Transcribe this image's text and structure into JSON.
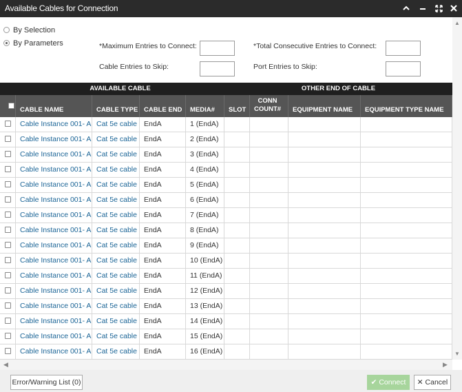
{
  "window": {
    "title": "Available Cables for Connection"
  },
  "mode": {
    "by_selection_label": "By Selection",
    "by_parameters_label": "By Parameters",
    "selected": "By Parameters"
  },
  "params": {
    "max_entries_label": "*Maximum Entries to Connect:",
    "total_consecutive_label": "*Total Consecutive Entries to Connect:",
    "cable_skip_label": "Cable Entries to Skip:",
    "port_skip_label": "Port Entries to Skip:",
    "max_entries_value": "",
    "total_consecutive_value": "",
    "cable_skip_value": "",
    "port_skip_value": ""
  },
  "table": {
    "group_available": "AVAILABLE CABLE",
    "group_other_end": "OTHER END OF CABLE",
    "columns": {
      "cable_name": "CABLE NAME",
      "cable_type": "CABLE TYPE",
      "cable_end": "CABLE END",
      "media": "MEDIA#",
      "slot": "SLOT",
      "conn_count_line1": "CONN",
      "conn_count_line2": "COUNT#",
      "equipment_name": "EQUIPMENT NAME",
      "equipment_type_name": "EQUIPMENT TYPE NAME"
    },
    "rows": [
      {
        "cable_name": "Cable Instance 001- A",
        "cable_type": "Cat 5e cable",
        "cable_end": "EndA",
        "media": "1 (EndA)",
        "slot": "",
        "conn_count": "",
        "equipment_name": "",
        "equipment_type_name": ""
      },
      {
        "cable_name": "Cable Instance 001- A",
        "cable_type": "Cat 5e cable",
        "cable_end": "EndA",
        "media": "2 (EndA)",
        "slot": "",
        "conn_count": "",
        "equipment_name": "",
        "equipment_type_name": ""
      },
      {
        "cable_name": "Cable Instance 001- A",
        "cable_type": "Cat 5e cable",
        "cable_end": "EndA",
        "media": "3 (EndA)",
        "slot": "",
        "conn_count": "",
        "equipment_name": "",
        "equipment_type_name": ""
      },
      {
        "cable_name": "Cable Instance 001- A",
        "cable_type": "Cat 5e cable",
        "cable_end": "EndA",
        "media": "4 (EndA)",
        "slot": "",
        "conn_count": "",
        "equipment_name": "",
        "equipment_type_name": ""
      },
      {
        "cable_name": "Cable Instance 001- A",
        "cable_type": "Cat 5e cable",
        "cable_end": "EndA",
        "media": "5 (EndA)",
        "slot": "",
        "conn_count": "",
        "equipment_name": "",
        "equipment_type_name": ""
      },
      {
        "cable_name": "Cable Instance 001- A",
        "cable_type": "Cat 5e cable",
        "cable_end": "EndA",
        "media": "6 (EndA)",
        "slot": "",
        "conn_count": "",
        "equipment_name": "",
        "equipment_type_name": ""
      },
      {
        "cable_name": "Cable Instance 001- A",
        "cable_type": "Cat 5e cable",
        "cable_end": "EndA",
        "media": "7 (EndA)",
        "slot": "",
        "conn_count": "",
        "equipment_name": "",
        "equipment_type_name": ""
      },
      {
        "cable_name": "Cable Instance 001- A",
        "cable_type": "Cat 5e cable",
        "cable_end": "EndA",
        "media": "8 (EndA)",
        "slot": "",
        "conn_count": "",
        "equipment_name": "",
        "equipment_type_name": ""
      },
      {
        "cable_name": "Cable Instance 001- A",
        "cable_type": "Cat 5e cable",
        "cable_end": "EndA",
        "media": "9 (EndA)",
        "slot": "",
        "conn_count": "",
        "equipment_name": "",
        "equipment_type_name": ""
      },
      {
        "cable_name": "Cable Instance 001- A",
        "cable_type": "Cat 5e cable",
        "cable_end": "EndA",
        "media": "10 (EndA)",
        "slot": "",
        "conn_count": "",
        "equipment_name": "",
        "equipment_type_name": ""
      },
      {
        "cable_name": "Cable Instance 001- A",
        "cable_type": "Cat 5e cable",
        "cable_end": "EndA",
        "media": "11 (EndA)",
        "slot": "",
        "conn_count": "",
        "equipment_name": "",
        "equipment_type_name": ""
      },
      {
        "cable_name": "Cable Instance 001- A",
        "cable_type": "Cat 5e cable",
        "cable_end": "EndA",
        "media": "12 (EndA)",
        "slot": "",
        "conn_count": "",
        "equipment_name": "",
        "equipment_type_name": ""
      },
      {
        "cable_name": "Cable Instance 001- A",
        "cable_type": "Cat 5e cable",
        "cable_end": "EndA",
        "media": "13 (EndA)",
        "slot": "",
        "conn_count": "",
        "equipment_name": "",
        "equipment_type_name": ""
      },
      {
        "cable_name": "Cable Instance 001- A",
        "cable_type": "Cat 5e cable",
        "cable_end": "EndA",
        "media": "14 (EndA)",
        "slot": "",
        "conn_count": "",
        "equipment_name": "",
        "equipment_type_name": ""
      },
      {
        "cable_name": "Cable Instance 001- A",
        "cable_type": "Cat 5e cable",
        "cable_end": "EndA",
        "media": "15 (EndA)",
        "slot": "",
        "conn_count": "",
        "equipment_name": "",
        "equipment_type_name": ""
      },
      {
        "cable_name": "Cable Instance 001- A",
        "cable_type": "Cat 5e cable",
        "cable_end": "EndA",
        "media": "16 (EndA)",
        "slot": "",
        "conn_count": "",
        "equipment_name": "",
        "equipment_type_name": ""
      }
    ]
  },
  "footer": {
    "error_list_label": "Error/Warning List (0)",
    "connect_label": "Connect",
    "cancel_label": "Cancel"
  },
  "icons": {
    "collapse": "chevron-up-icon",
    "minimize": "minimize-icon",
    "maximize": "expand-icon",
    "close": "close-icon",
    "connect": "check-icon",
    "cancel": "close-icon"
  },
  "colors": {
    "titlebar": "#2b2b2b",
    "group_header": "#1f1f1f",
    "column_header": "#555555",
    "link": "#1a6496",
    "connect_button": "#a7d59c"
  }
}
